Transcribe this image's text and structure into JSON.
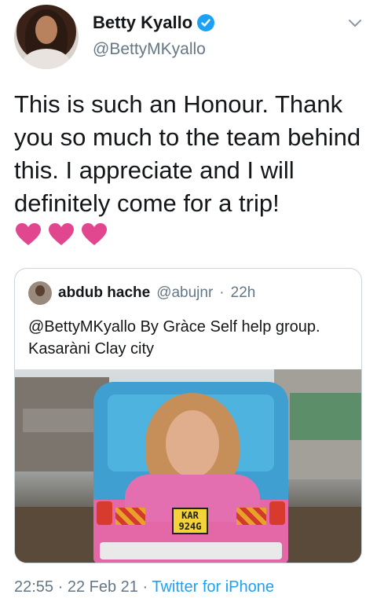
{
  "author": {
    "display_name": "Betty Kyallo",
    "handle": "@BettyMKyallo",
    "verified": true
  },
  "tweet": {
    "text": "This is such an Honour. Thank you so much to the team behind this. I appreciate and I will definitely come for a trip!",
    "emoji": "pink-heart x3"
  },
  "quoted_tweet": {
    "display_name": "abdub hache",
    "handle": "@abujnr",
    "separator": "·",
    "time": "22h",
    "text": "@BettyMKyallo By Gràce Self help group. Kasaràni Clay city",
    "image": {
      "plate_line1": "KAR",
      "plate_line2": "924G"
    }
  },
  "meta": {
    "time": "22:55",
    "separator1": "·",
    "date": "22 Feb 21",
    "separator2": "·",
    "source": "Twitter for iPhone"
  },
  "colors": {
    "accent": "#1da1f2",
    "secondary_text": "#657786",
    "heart": "#e0245e"
  }
}
